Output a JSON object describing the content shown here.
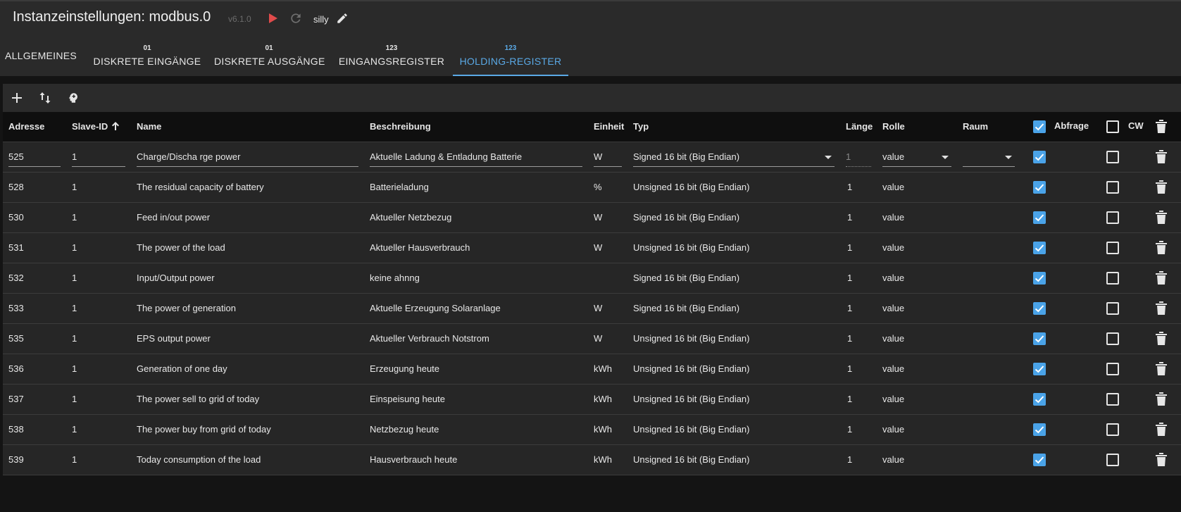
{
  "header": {
    "title": "Instanzeinstellungen: modbus.0",
    "version": "v6.1.0",
    "loglevel": "silly"
  },
  "tabs": [
    {
      "badge": "",
      "label": "ALLGEMEINES"
    },
    {
      "badge": "01",
      "label": "DISKRETE EINGÄNGE"
    },
    {
      "badge": "01",
      "label": "DISKRETE AUSGÄNGE"
    },
    {
      "badge": "123",
      "label": "EINGANGSREGISTER"
    },
    {
      "badge": "123",
      "label": "HOLDING-REGISTER"
    }
  ],
  "columns": {
    "address": "Adresse",
    "slave_id": "Slave-ID",
    "name": "Name",
    "description": "Beschreibung",
    "unit": "Einheit",
    "type": "Typ",
    "length": "Länge",
    "role": "Rolle",
    "room": "Raum",
    "poll": "Abfrage",
    "cw": "CW"
  },
  "header_checks": {
    "poll": true,
    "cw": false
  },
  "rows": [
    {
      "address": "525",
      "slave_id": "1",
      "name": "Charge/Discha rge power",
      "description": "Aktuelle Ladung & Entladung Batterie",
      "unit": "W",
      "type": "Signed 16 bit (Big Endian)",
      "length": "1",
      "role": "value",
      "room": "",
      "poll": true,
      "cw": false
    },
    {
      "address": "528",
      "slave_id": "1",
      "name": "The residual capacity of battery",
      "description": "Batterieladung",
      "unit": "%",
      "type": "Unsigned 16 bit (Big Endian)",
      "length": "1",
      "role": "value",
      "room": "",
      "poll": true,
      "cw": false
    },
    {
      "address": "530",
      "slave_id": "1",
      "name": "Feed in/out power",
      "description": "Aktueller Netzbezug",
      "unit": "W",
      "type": "Signed 16 bit (Big Endian)",
      "length": "1",
      "role": "value",
      "room": "",
      "poll": true,
      "cw": false
    },
    {
      "address": "531",
      "slave_id": "1",
      "name": "The power of the load",
      "description": "Aktueller Hausverbrauch",
      "unit": "W",
      "type": "Unsigned 16 bit (Big Endian)",
      "length": "1",
      "role": "value",
      "room": "",
      "poll": true,
      "cw": false
    },
    {
      "address": "532",
      "slave_id": "1",
      "name": "Input/Output power",
      "description": "keine ahnng",
      "unit": "",
      "type": "Signed 16 bit (Big Endian)",
      "length": "1",
      "role": "value",
      "room": "",
      "poll": true,
      "cw": false
    },
    {
      "address": "533",
      "slave_id": "1",
      "name": "The power of generation",
      "description": "Aktuelle Erzeugung Solaranlage",
      "unit": "W",
      "type": "Signed 16 bit (Big Endian)",
      "length": "1",
      "role": "value",
      "room": "",
      "poll": true,
      "cw": false
    },
    {
      "address": "535",
      "slave_id": "1",
      "name": "EPS output power",
      "description": "Aktueller Verbrauch Notstrom",
      "unit": "W",
      "type": "Unsigned 16 bit (Big Endian)",
      "length": "1",
      "role": "value",
      "room": "",
      "poll": true,
      "cw": false
    },
    {
      "address": "536",
      "slave_id": "1",
      "name": "Generation of one day",
      "description": "Erzeugung heute",
      "unit": "kWh",
      "type": "Unsigned 16 bit (Big Endian)",
      "length": "1",
      "role": "value",
      "room": "",
      "poll": true,
      "cw": false
    },
    {
      "address": "537",
      "slave_id": "1",
      "name": "The power sell to grid of today",
      "description": "Einspeisung heute",
      "unit": "kWh",
      "type": "Unsigned 16 bit (Big Endian)",
      "length": "1",
      "role": "value",
      "room": "",
      "poll": true,
      "cw": false
    },
    {
      "address": "538",
      "slave_id": "1",
      "name": "The power buy from grid of today",
      "description": "Netzbezug heute",
      "unit": "kWh",
      "type": "Unsigned 16 bit (Big Endian)",
      "length": "1",
      "role": "value",
      "room": "",
      "poll": true,
      "cw": false
    },
    {
      "address": "539",
      "slave_id": "1",
      "name": "Today consumption of the load",
      "description": "Hausverbrauch heute",
      "unit": "kWh",
      "type": "Unsigned 16 bit (Big Endian)",
      "length": "1",
      "role": "value",
      "room": "",
      "poll": true,
      "cw": false
    }
  ],
  "icons": {
    "start": "play-icon",
    "restart": "restart-icon",
    "edit": "pencil-icon",
    "add": "plus-icon",
    "sort": "swap-vertical-icon",
    "import": "head-icon",
    "delete": "trash-icon",
    "sort_indicator": "arrow-up-icon"
  },
  "colors": {
    "accent": "#5aa9e6",
    "checkbox": "#4aa3e8",
    "play": "#e04b4b"
  }
}
